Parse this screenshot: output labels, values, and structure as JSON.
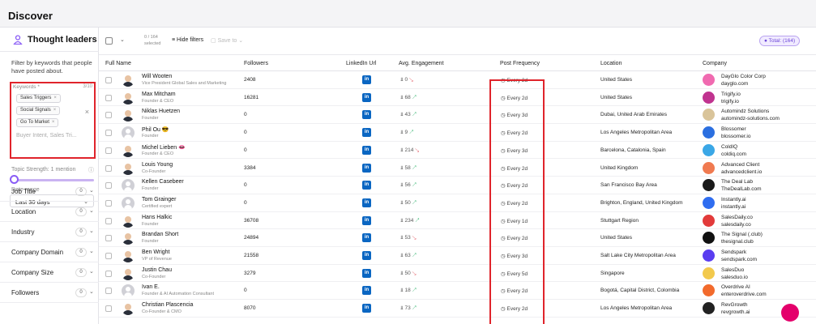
{
  "header": {
    "title": "Discover"
  },
  "sidebar": {
    "tab_label": "Thought leaders",
    "description": "Filter by keywords that people have posted about.",
    "keywords_label": "Keywords *",
    "keywords_count": "3/10",
    "keywords": [
      "Sales Triggers",
      "Social Signals",
      "Go To Market"
    ],
    "keywords_placeholder": "Buyer Intent, Sales Tri...",
    "topic_strength": "Topic Strength: 1 mention",
    "topic_strength_value": 1,
    "date_range_label": "Date range",
    "date_range_value": "Last 30 days",
    "filters": [
      {
        "name": "Job Title",
        "count": "0"
      },
      {
        "name": "Location",
        "count": "0"
      },
      {
        "name": "Industry",
        "count": "0"
      },
      {
        "name": "Company Domain",
        "count": "0"
      },
      {
        "name": "Company Size",
        "count": "0"
      },
      {
        "name": "Followers",
        "count": "0"
      }
    ]
  },
  "toolbar": {
    "selected_count": "0 / 164",
    "selected_label": "selected",
    "hide_filters": "Hide filters",
    "save_to": "Save to",
    "total": "Total: (164)"
  },
  "table": {
    "columns": [
      "Full Name",
      "Followers",
      "LinkedIn Url",
      "Avg. Engagement",
      "Post Frequency",
      "Location",
      "Company"
    ],
    "rows": [
      {
        "name": "Will Wooten",
        "title": "Vice President Global Sales and Marketing",
        "followers": "2408",
        "engagement": "0",
        "trend": "down",
        "frequency": "Every 2d",
        "location": "United States",
        "company": "DayGlo Color Corp",
        "domain": "dayglo.com",
        "avatar": "photo",
        "logo_color": "#f06ab0"
      },
      {
        "name": "Max Mitcham",
        "title": "Founder & CEO",
        "followers": "16281",
        "engagement": "68",
        "trend": "up",
        "frequency": "Every 2d",
        "location": "United States",
        "company": "Trigify.io",
        "domain": "trigify.io",
        "avatar": "photo",
        "logo_color": "#c0338f"
      },
      {
        "name": "Niklas Huetzen",
        "title": "Founder",
        "followers": "0",
        "engagement": "43",
        "trend": "up",
        "frequency": "Every 3d",
        "location": "Dubai, United Arab Emirates",
        "company": "Automindz Solutions",
        "domain": "automindz-solutions.com",
        "avatar": "photo",
        "logo_color": "#d9c49a"
      },
      {
        "name": "Phil Ou 😎",
        "title": "Founder",
        "followers": "0",
        "engagement": "9",
        "trend": "up",
        "frequency": "Every 2d",
        "location": "Los Angeles Metropolitan Area",
        "company": "Blossomer",
        "domain": "blossomer.io",
        "avatar": "blank",
        "logo_color": "#2b6fe0"
      },
      {
        "name": "Michel Lieben 👄",
        "title": "Founder & CEO",
        "followers": "0",
        "engagement": "214",
        "trend": "down",
        "frequency": "Every 3d",
        "location": "Barcelona, Catalonia, Spain",
        "company": "ColdIQ",
        "domain": "coldiq.com",
        "avatar": "photo",
        "logo_color": "#3aa7e6"
      },
      {
        "name": "Louis Young",
        "title": "Co-Founder",
        "followers": "3384",
        "engagement": "58",
        "trend": "up",
        "frequency": "Every 2d",
        "location": "United Kingdom",
        "company": "Advanced Client",
        "domain": "advancedclient.io",
        "avatar": "photo",
        "logo_color": "#f07a50"
      },
      {
        "name": "Kellen Casebeer",
        "title": "Founder",
        "followers": "0",
        "engagement": "56",
        "trend": "up",
        "frequency": "Every 2d",
        "location": "San Francisco Bay Area",
        "company": "The Deal Lab",
        "domain": "TheDealLab.com",
        "avatar": "blank",
        "logo_color": "#1a1a1a"
      },
      {
        "name": "Tom Grainger",
        "title": "Certified expert",
        "followers": "0",
        "engagement": "50",
        "trend": "up",
        "frequency": "Every 2d",
        "location": "Brighton, England, United Kingdom",
        "company": "Instantly.ai",
        "domain": "instantly.ai",
        "avatar": "blank",
        "logo_color": "#2f6df0"
      },
      {
        "name": "Hans Halkic",
        "title": "Founder",
        "followers": "36708",
        "engagement": "234",
        "trend": "up",
        "frequency": "Every 1d",
        "location": "Stuttgart Region",
        "company": "SalesDaily.co",
        "domain": "salesdaily.co",
        "avatar": "photo",
        "logo_color": "#e23a3a"
      },
      {
        "name": "Brandan Short",
        "title": "Founder",
        "followers": "24894",
        "engagement": "53",
        "trend": "down",
        "frequency": "Every 2d",
        "location": "United States",
        "company": "The Signal (.club)",
        "domain": "thesignal.club",
        "avatar": "photo",
        "logo_color": "#111111"
      },
      {
        "name": "Ben Wright",
        "title": "VP of Revenue",
        "followers": "21558",
        "engagement": "63",
        "trend": "up",
        "frequency": "Every 3d",
        "location": "Salt Lake City Metropolitan Area",
        "company": "Sendspark",
        "domain": "sendspark.com",
        "avatar": "photo",
        "logo_color": "#5a3df0"
      },
      {
        "name": "Justin Chau",
        "title": "Co-Founder",
        "followers": "3279",
        "engagement": "50",
        "trend": "down",
        "frequency": "Every 5d",
        "location": "Singapore",
        "company": "SalesDuo",
        "domain": "salesduo.io",
        "avatar": "photo",
        "logo_color": "#f2c94c"
      },
      {
        "name": "Ivan E.",
        "title": "Founder & AI Automation Consultant",
        "followers": "0",
        "engagement": "18",
        "trend": "up",
        "frequency": "Every 2d",
        "location": "Bogotá, Capital District, Colombia",
        "company": "Overdrive AI",
        "domain": "enteroverdrive.com",
        "avatar": "blank",
        "logo_color": "#f26a2c"
      },
      {
        "name": "Christian Plascencia",
        "title": "Co-Founder & CMO",
        "followers": "8070",
        "engagement": "73",
        "trend": "up",
        "frequency": "Every 2d",
        "location": "Los Angeles Metropolitan Area",
        "company": "RevGrowth",
        "domain": "revgrowth.ai",
        "avatar": "photo",
        "logo_color": "#222222"
      }
    ]
  },
  "colors": {
    "accent": "#8a5cf6",
    "highlight": "#e0242b",
    "linkedin": "#0a66c2",
    "up": "#2fb36b",
    "down": "#e0505a"
  },
  "icons": {
    "sidebar_tab": "person-icon",
    "linkedin": "linkedin-icon",
    "engagement": "engagement-icon",
    "frequency": "clock-icon",
    "help": "chat-bubble-icon"
  }
}
